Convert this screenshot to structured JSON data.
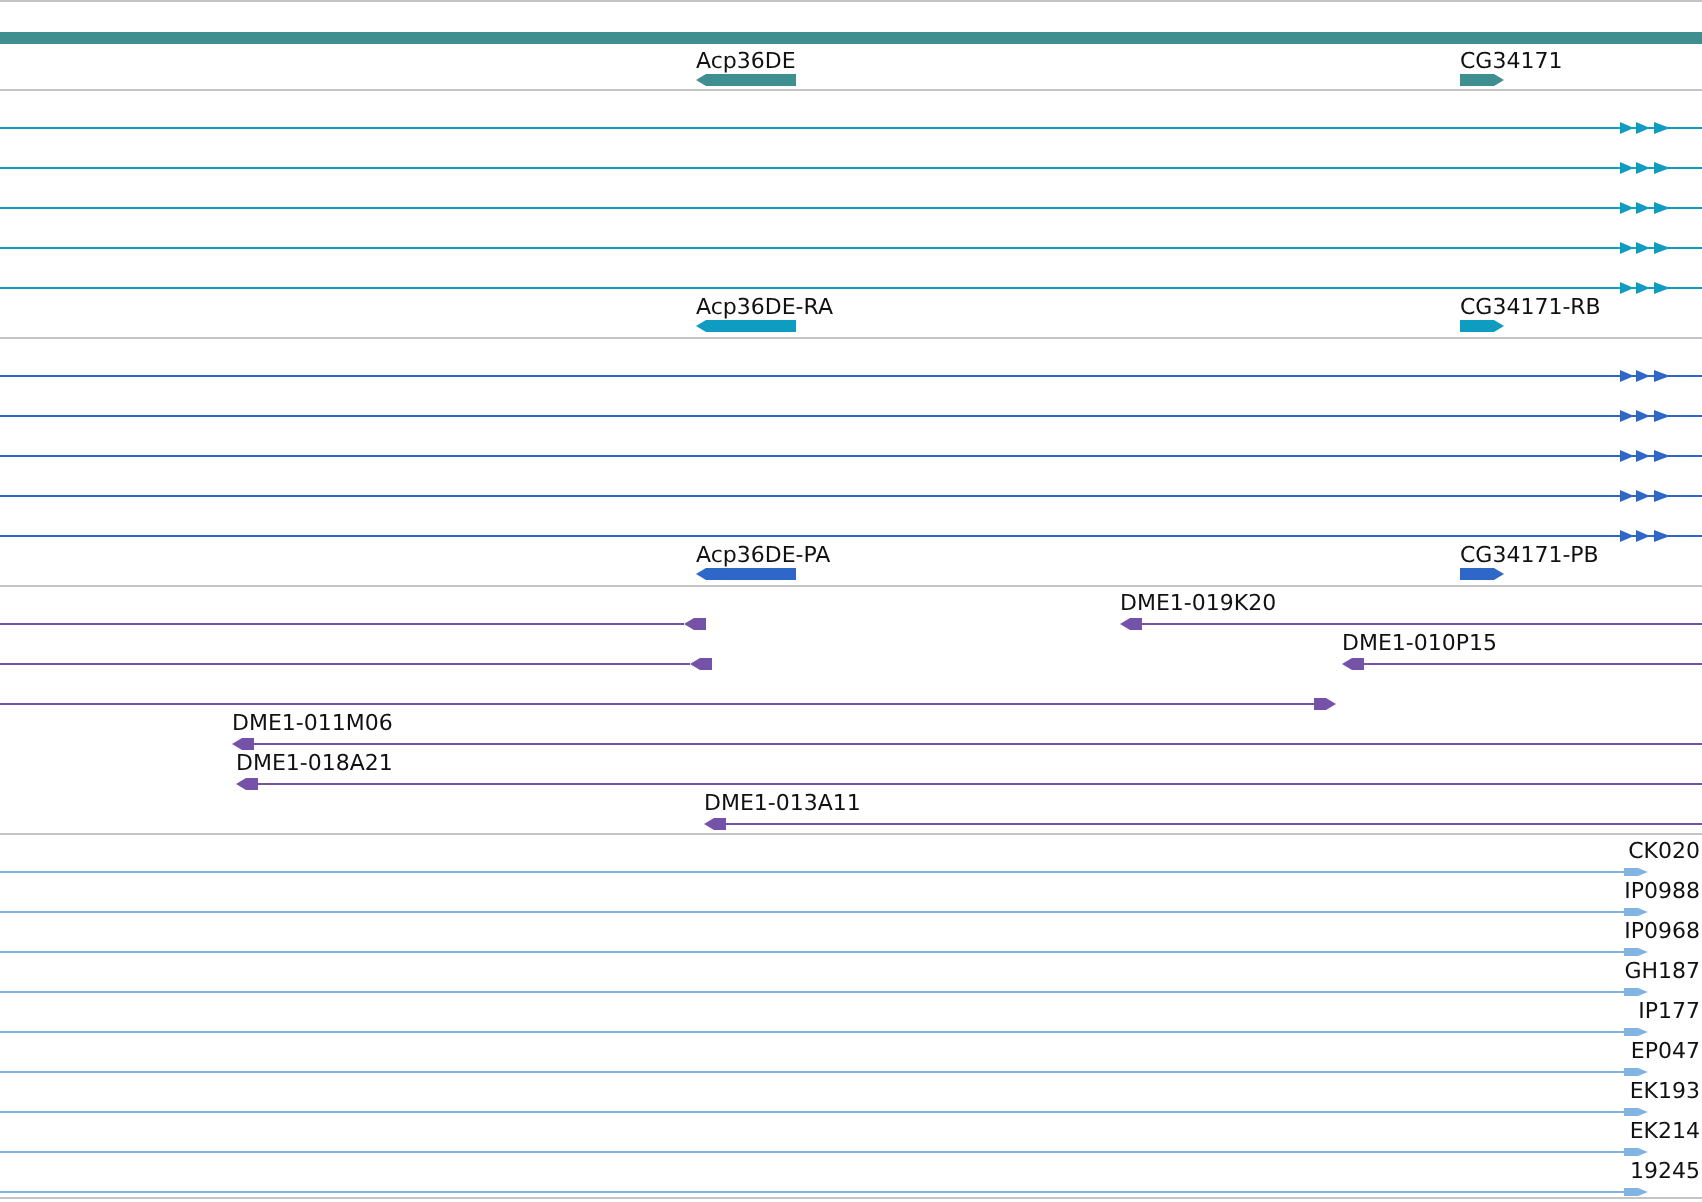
{
  "tracks": [
    {
      "kind": "gene",
      "color": "#3f8f91",
      "features": [
        {
          "label": "Acp36DE",
          "reverse": true
        },
        {
          "label": "CG34171",
          "reverse": false
        }
      ]
    },
    {
      "kind": "transcript",
      "color": "#0e9dc1",
      "features": [
        {
          "label": "Acp36DE-RA",
          "reverse": true
        },
        {
          "label": "CG34171-RB",
          "reverse": false
        }
      ]
    },
    {
      "kind": "transcript",
      "color": "#2f67c9",
      "features": [
        {
          "label": "Acp36DE-PA",
          "reverse": true
        },
        {
          "label": "CG34171-PB",
          "reverse": false
        }
      ]
    },
    {
      "kind": "alignment",
      "color": "#7452a8",
      "features": [
        {
          "label": "DME1-019K20",
          "reverse": true
        },
        {
          "label": "DME1-010P15",
          "reverse": true
        },
        {
          "label": "DME1-011M06",
          "reverse": true
        },
        {
          "label": "DME1-018A21",
          "reverse": true
        },
        {
          "label": "DME1-013A11",
          "reverse": true
        }
      ]
    },
    {
      "kind": "est",
      "color": "#7fb5e0",
      "features": [
        {
          "label": "CK020",
          "reverse": false
        },
        {
          "label": "IP0988",
          "reverse": false
        },
        {
          "label": "IP0968",
          "reverse": false
        },
        {
          "label": "GH187",
          "reverse": false
        },
        {
          "label": "IP177",
          "reverse": false
        },
        {
          "label": "EP047",
          "reverse": false
        },
        {
          "label": "EK193",
          "reverse": false
        },
        {
          "label": "EK214",
          "reverse": false
        },
        {
          "label": "19245",
          "reverse": false
        }
      ]
    }
  ]
}
